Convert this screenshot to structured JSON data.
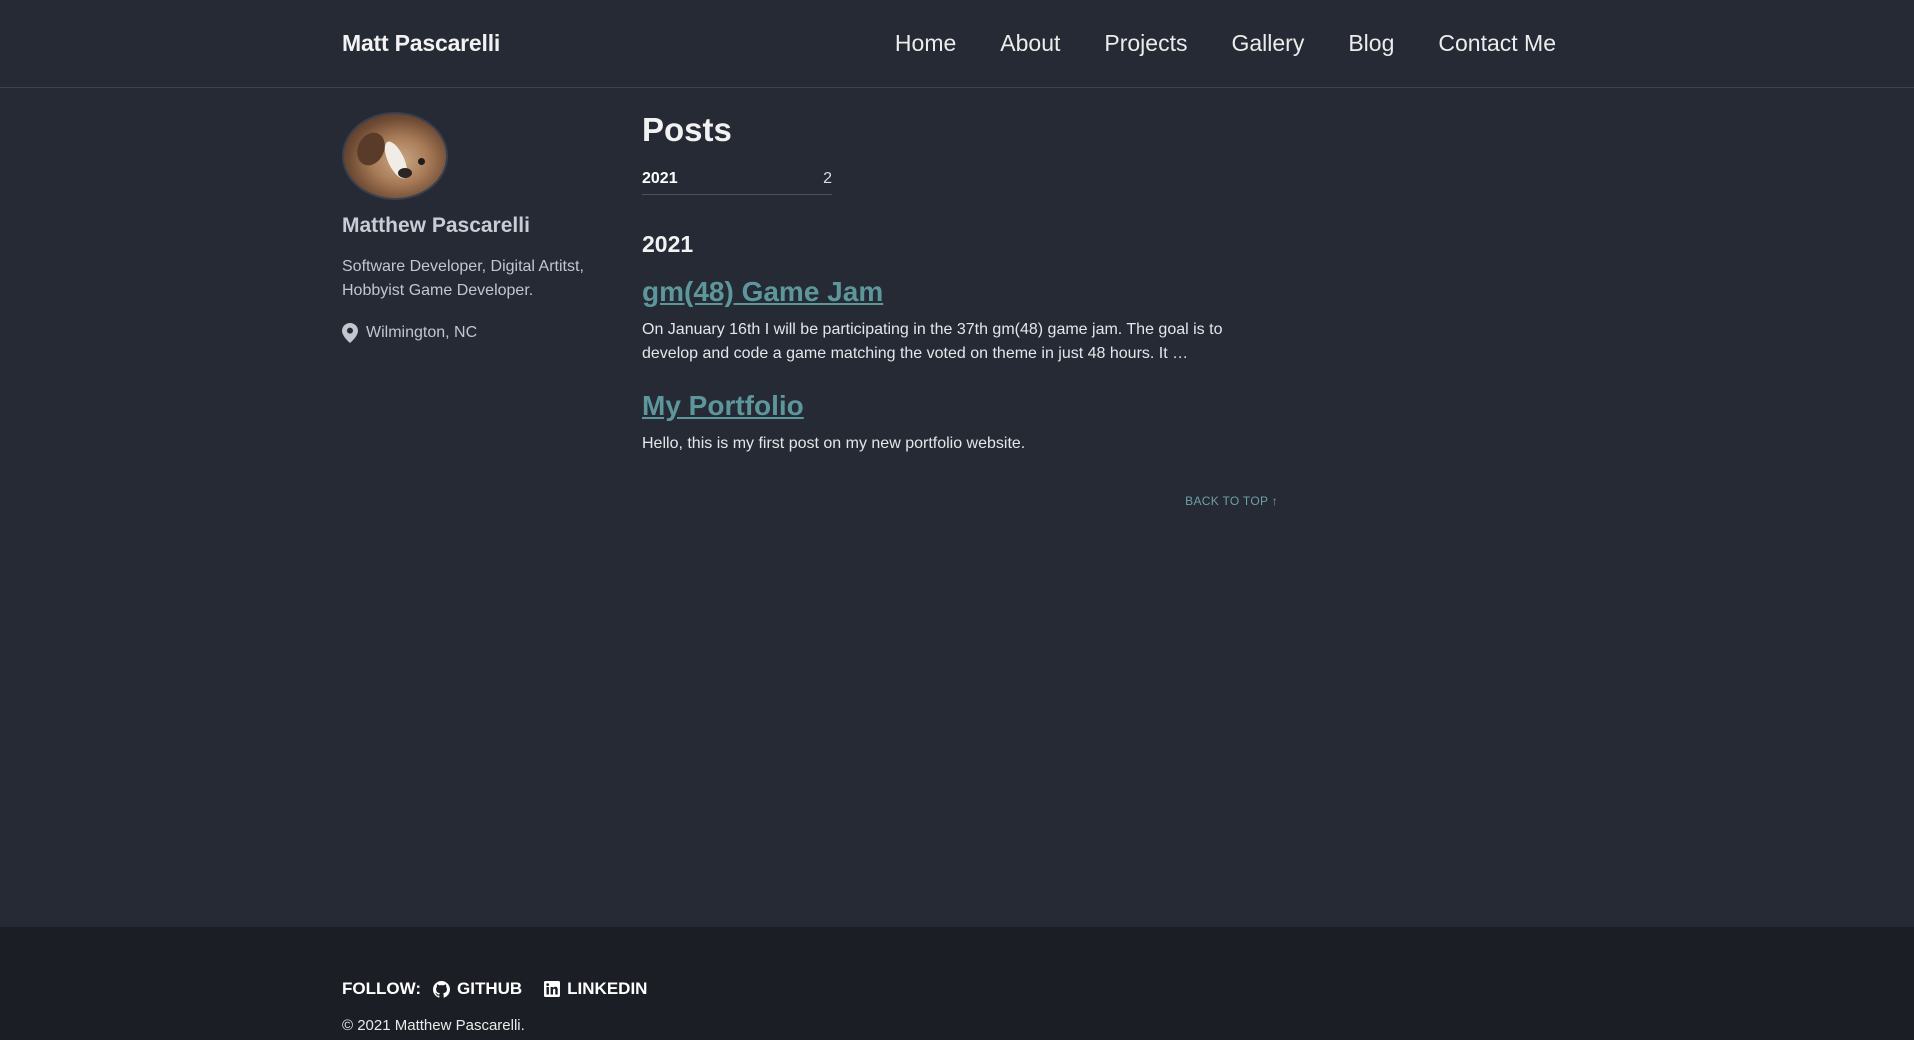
{
  "masthead": {
    "site_title": "Matt Pascarelli",
    "nav": [
      {
        "label": "Home"
      },
      {
        "label": "About"
      },
      {
        "label": "Projects"
      },
      {
        "label": "Gallery"
      },
      {
        "label": "Blog"
      },
      {
        "label": "Contact Me"
      }
    ]
  },
  "sidebar": {
    "avatar_icon": "avatar-dog-photo",
    "name": "Matthew Pascarelli",
    "bio": "Software Developer, Digital Artitst, Hobbyist Game Developer.",
    "location_icon": "map-marker-icon",
    "location": "Wilmington, NC"
  },
  "main": {
    "title": "Posts",
    "taxonomy": [
      {
        "year": "2021",
        "count": "2"
      }
    ],
    "archive": [
      {
        "year": "2021",
        "posts": [
          {
            "title": "gm(48) Game Jam",
            "excerpt": "On January 16th I will be participating in the 37th gm(48) game jam. The goal is to develop and code a game matching the voted on theme in just 48 hours. It …"
          },
          {
            "title": "My Portfolio",
            "excerpt": "Hello, this is my first post on my new portfolio website."
          }
        ]
      }
    ],
    "back_to_top": "BACK TO TOP ↑"
  },
  "footer": {
    "follow_label": "FOLLOW:",
    "links": [
      {
        "label": "GITHUB",
        "icon": "github-icon"
      },
      {
        "label": "LINKEDIN",
        "icon": "linkedin-icon"
      }
    ],
    "copyright": "© 2021 Matthew Pascarelli."
  },
  "colors": {
    "background": "#252a34",
    "footer_background": "#1b1e25",
    "link": "#5d979c",
    "text": "#eaeaea"
  }
}
